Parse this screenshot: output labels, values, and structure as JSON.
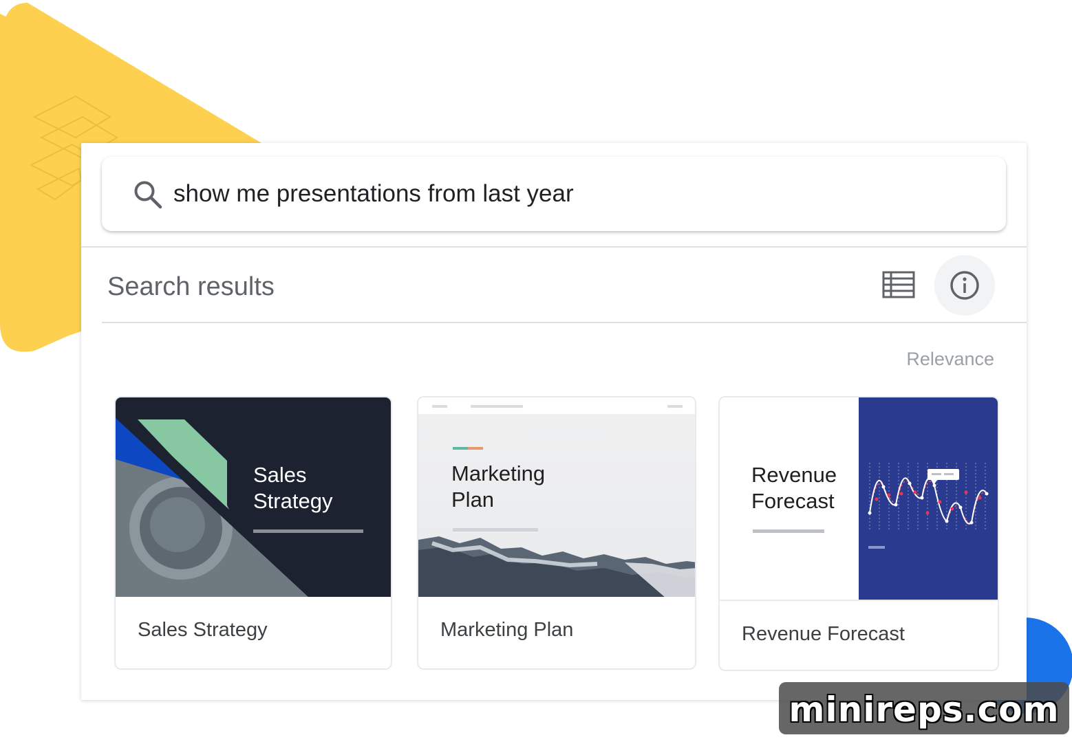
{
  "search": {
    "query": "show me presentations from last year",
    "icon": "search-icon"
  },
  "results": {
    "title": "Search results",
    "sort_label": "Relevance",
    "list_view_icon": "list-view-icon",
    "info_icon": "info-icon"
  },
  "cards": [
    {
      "thumb_title_line1": "Sales",
      "thumb_title_line2": "Strategy",
      "label": "Sales Strategy"
    },
    {
      "thumb_title_line1": "Marketing",
      "thumb_title_line2": "Plan",
      "label": "Marketing Plan"
    },
    {
      "thumb_title_line1": "Revenue",
      "thumb_title_line2": "Forecast",
      "label": "Revenue Forecast"
    }
  ],
  "watermark": {
    "text": "minireps.com"
  },
  "colors": {
    "accent_yellow": "#FDD04F",
    "accent_blue": "#1A73E8",
    "sales_dark": "#1C2230",
    "sales_green": "#87C8A3",
    "sales_blue": "#0D47C2",
    "revenue_navy": "#2A3A8E"
  }
}
